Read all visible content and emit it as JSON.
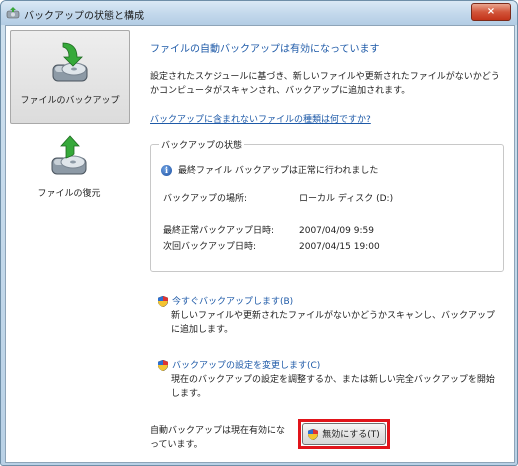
{
  "window": {
    "title": "バックアップの状態と構成",
    "close_label": "×"
  },
  "sidebar": {
    "items": [
      {
        "label": "ファイルのバックアップ",
        "selected": true,
        "icon": "backup-drive-icon"
      },
      {
        "label": "ファイルの復元",
        "selected": false,
        "icon": "restore-drive-icon"
      }
    ]
  },
  "main": {
    "heading": "ファイルの自動バックアップは有効になっています",
    "description": "設定されたスケジュールに基づき、新しいファイルや更新されたファイルがないかどうかコンピュータがスキャンされ、バックアップに追加されます。",
    "link": "バックアップに含まれないファイルの種類は何ですか?",
    "status_group": {
      "title": "バックアップの状態",
      "status_message": "最終ファイル バックアップは正常に行われました",
      "location_label": "バックアップの場所:",
      "location_value": "ローカル ディスク (D:)",
      "last_label": "最終正常バックアップ日時:",
      "last_value": "2007/04/09 9:59",
      "next_label": "次回バックアップ日時:",
      "next_value": "2007/04/15 19:00"
    },
    "actions": [
      {
        "title": "今すぐバックアップします(B)",
        "description": "新しいファイルや更新されたファイルがないかどうかスキャンし、バックアップに追加します。"
      },
      {
        "title": "バックアップの設定を変更します(C)",
        "description": "現在のバックアップの設定を調整するか、または新しい完全バックアップを開始します。"
      }
    ],
    "footer_text": "自動バックアップは現在有効になっています。",
    "disable_button": "無効にする(T)"
  },
  "colors": {
    "link": "#1e5aa8",
    "highlight": "#e1141a"
  }
}
